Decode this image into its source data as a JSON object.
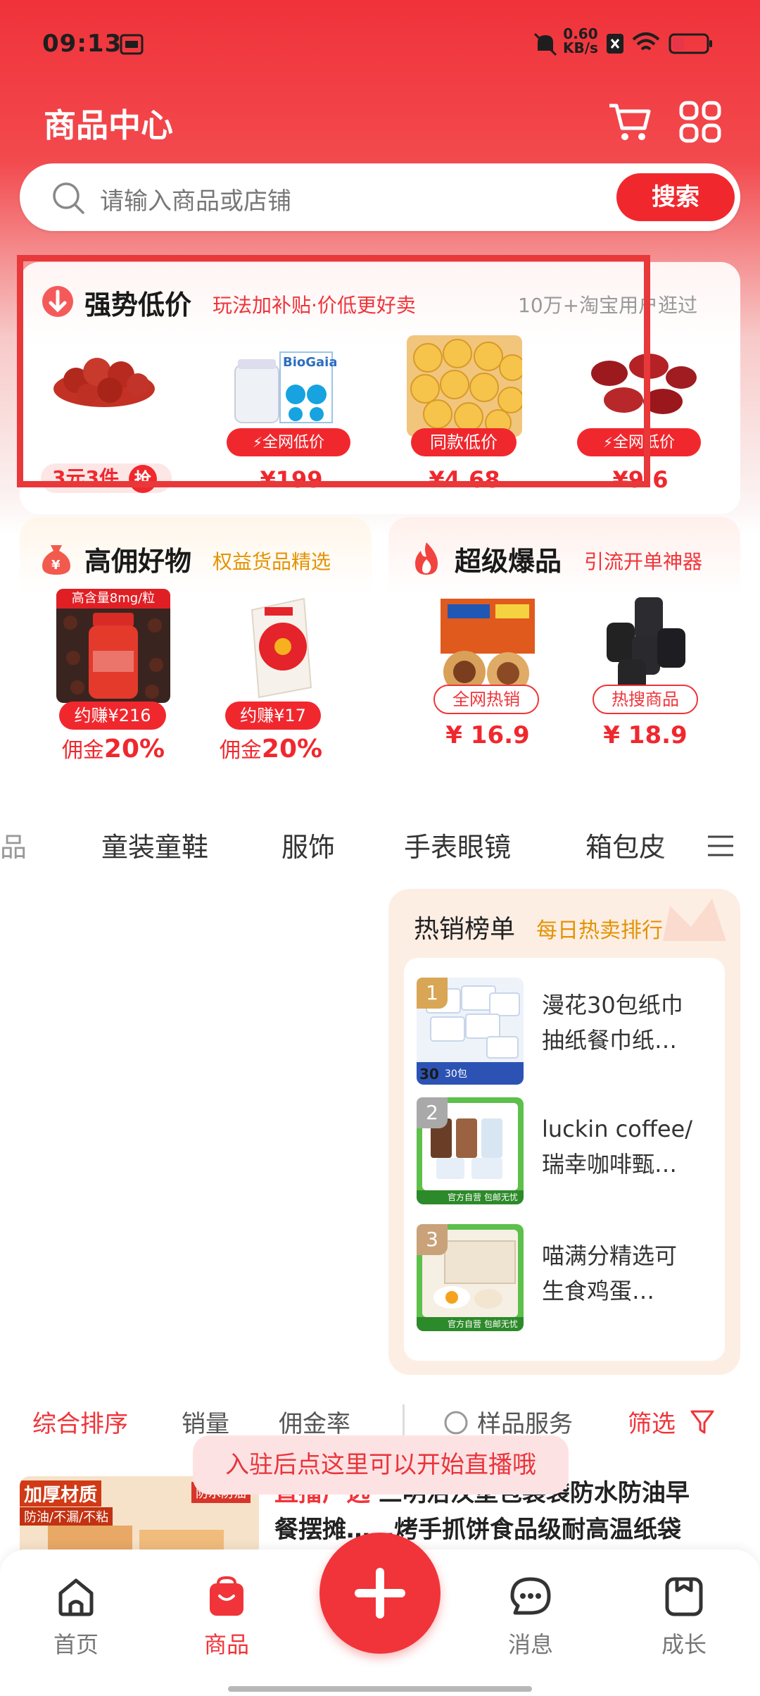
{
  "status_bar": {
    "time": "09:13",
    "net_speed_value": "0.60",
    "net_speed_unit": "KB/s",
    "battery_level": 0.35
  },
  "header": {
    "title": "商品中心",
    "cart_icon": "cart-icon",
    "grid_icon": "grid-icon"
  },
  "search": {
    "placeholder": "请输入商品或店铺",
    "button": "搜索"
  },
  "low_price": {
    "title": "强势低价",
    "subtitle": "玩法加补贴·价低更好卖",
    "note": "10万+淘宝用户逛过",
    "items": [
      {
        "tag": "3元3件",
        "tag2": "抢",
        "price": ""
      },
      {
        "tag": "全网低价",
        "price": "¥199"
      },
      {
        "tag": "同款低价",
        "price": "¥4.68"
      },
      {
        "tag": "全网低价",
        "price": "¥9.6"
      }
    ]
  },
  "high_commission": {
    "title": "高佣好物",
    "subtitle": "权益货品精选",
    "items": [
      {
        "badge": "约赚¥216",
        "label": "佣金",
        "rate": "20%",
        "img_text": "高含量8mg/粒"
      },
      {
        "badge": "约赚¥17",
        "label": "佣金",
        "rate": "20%"
      }
    ]
  },
  "super_hot": {
    "title": "超级爆品",
    "subtitle": "引流开单神器",
    "items": [
      {
        "badge": "全网热销",
        "price": "¥ 16.9"
      },
      {
        "badge": "热搜商品",
        "price": "¥ 18.9"
      }
    ]
  },
  "categories": [
    "品",
    "童装童鞋",
    "服饰",
    "手表眼镜",
    "箱包皮"
  ],
  "hot_list": {
    "title": "热销榜单",
    "subtitle": "每日热卖排行",
    "items": [
      {
        "rank": "1",
        "name_line1": "漫花30包纸巾",
        "name_line2": "抽纸餐巾纸…",
        "img_text": "30包"
      },
      {
        "rank": "2",
        "name_line1": "luckin coffee/",
        "name_line2": "瑞幸咖啡甄…",
        "img_text": "官方自营 包邮无忧"
      },
      {
        "rank": "3",
        "name_line1": "喵满分精选可",
        "name_line2": "生食鸡蛋…",
        "img_text": "官方自营 包邮无忧"
      }
    ]
  },
  "sort_bar": {
    "comprehensive": "综合排序",
    "sales": "销量",
    "commission": "佣金率",
    "sample": "样品服务",
    "filter": "筛选"
  },
  "toast": "入驻后点这里可以开始直播哦",
  "product": {
    "title_tag": "直播广选",
    "title_line1": "三明治汉堡包装袋防水防油早",
    "title_line2": "餐摆摊……烤手抓饼食品级耐高温纸袋",
    "img_tag1": "加厚材质",
    "img_tag2": "防油/不漏/不粘",
    "img_tag3": "防水防油"
  },
  "bottom_nav": [
    {
      "label": "首页",
      "icon": "home-icon"
    },
    {
      "label": "商品",
      "icon": "bag-icon"
    },
    {
      "label": "",
      "icon": "plus-icon"
    },
    {
      "label": "消息",
      "icon": "message-icon"
    },
    {
      "label": "成长",
      "icon": "growth-icon"
    }
  ],
  "colors": {
    "brand_red": "#f0282e",
    "orange": "#e39300"
  }
}
